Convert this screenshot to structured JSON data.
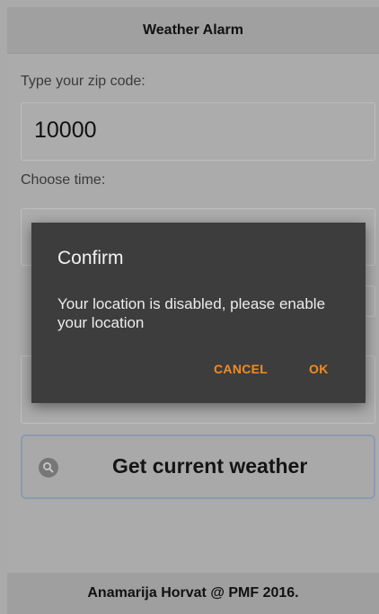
{
  "header": {
    "title": "Weather Alarm"
  },
  "form": {
    "zip_label": "Type your zip code:",
    "zip_value": "10000",
    "time_label": "Choose time:"
  },
  "weather_button": {
    "label": "Get current weather",
    "icon": "search-icon"
  },
  "footer": {
    "text": "Anamarija Horvat @ PMF 2016."
  },
  "dialog": {
    "title": "Confirm",
    "message": "Your location is disabled, please enable your location",
    "cancel_label": "CANCEL",
    "ok_label": "OK"
  },
  "colors": {
    "accent": "#f28c22",
    "dialog_bg": "#3d3d3d"
  }
}
